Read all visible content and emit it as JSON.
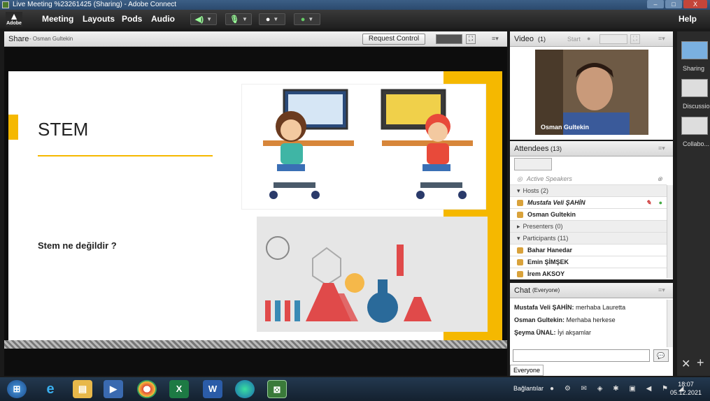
{
  "window": {
    "title": "Live Meeting %23261425 (Sharing) - Adobe Connect",
    "min": "–",
    "max": "□",
    "close": "X"
  },
  "menubar": {
    "logo": "Adobe",
    "items": [
      "Meeting",
      "Layouts",
      "Pods",
      "Audio"
    ],
    "help": "Help"
  },
  "share_pod": {
    "title": "Share",
    "presenter": "- Osman Gultekin",
    "request_control": "Request Control"
  },
  "slide": {
    "title": "STEM",
    "question": "Stem ne değildir ?"
  },
  "video_pod": {
    "title": "Video",
    "count": "(1)",
    "start": "Start",
    "speaker_name": "Osman Gultekin"
  },
  "attendees_pod": {
    "title": "Attendees",
    "count": "(13)",
    "active_speakers": "Active Speakers",
    "hosts_header": "Hosts (2)",
    "hosts": [
      "Mustafa Veli ŞAHİN",
      "Osman Gultekin"
    ],
    "presenters_header": "Presenters (0)",
    "participants_header": "Participants (11)",
    "participants": [
      "Bahar Hanedar",
      "Emin ŞİMŞEK",
      "İrem AKSOY"
    ]
  },
  "chat_pod": {
    "title": "Chat",
    "scope": "(Everyone)",
    "messages": [
      {
        "author": "Mustafa Veli ŞAHİN:",
        "text": "merhaba Lauretta"
      },
      {
        "author": "Osman Gultekin:",
        "text": "Merhaba herkese"
      },
      {
        "author": "Şeyma ÜNAL:",
        "text": "İyi akşamlar"
      }
    ],
    "tab": "Everyone"
  },
  "layouts": [
    "Sharing",
    "Discussion",
    "Collabo..."
  ],
  "taskbar": {
    "tray_label": "Bağlantılar",
    "time": "18:07",
    "date": "05.12.2021"
  }
}
